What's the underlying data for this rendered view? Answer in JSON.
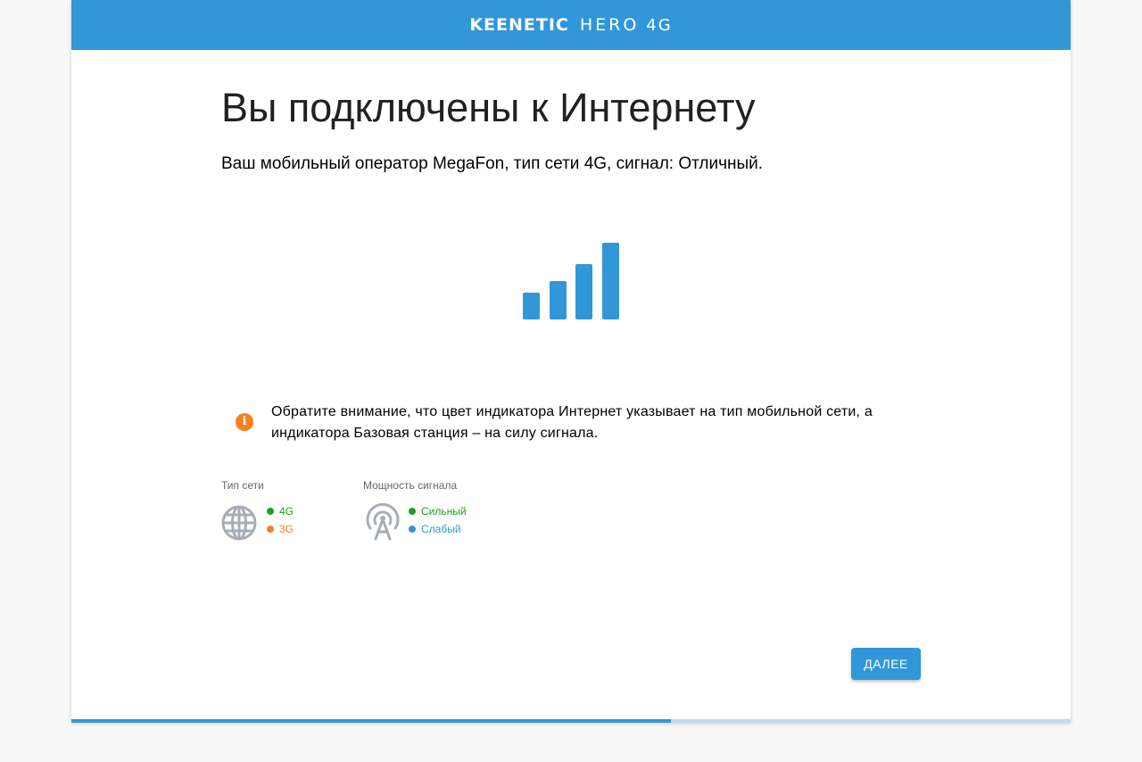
{
  "header": {
    "brand": "KEENETIC",
    "model": "HERO",
    "generation": "4G",
    "color": "#3197d9"
  },
  "main": {
    "title": "Вы подключены к Интернету",
    "subtitle": "Ваш мобильный оператор MegaFon, тип сети 4G, сигнал: Отличный.",
    "signal_level": 4,
    "signal_max": 4,
    "notice_icon": "info-icon",
    "notice": "Обратите внимание, что цвет индикатора Интернет указывает на тип мобильной сети, а индикатора Базовая станция – на силу сигнала."
  },
  "legend": {
    "network": {
      "title": "Тип сети",
      "icon": "globe-icon",
      "items": [
        {
          "label": "4G",
          "color": "#1aa01f"
        },
        {
          "label": "3G",
          "color": "#f4831f"
        }
      ]
    },
    "signal": {
      "title": "Мощность сигнала",
      "icon": "antenna-tower-icon",
      "items": [
        {
          "label": "Сильный",
          "color": "#1aa01f"
        },
        {
          "label": "Слабый",
          "color": "#3197d9"
        }
      ]
    }
  },
  "actions": {
    "next_label": "ДАЛЕЕ"
  },
  "progress": {
    "fraction": 0.6
  }
}
